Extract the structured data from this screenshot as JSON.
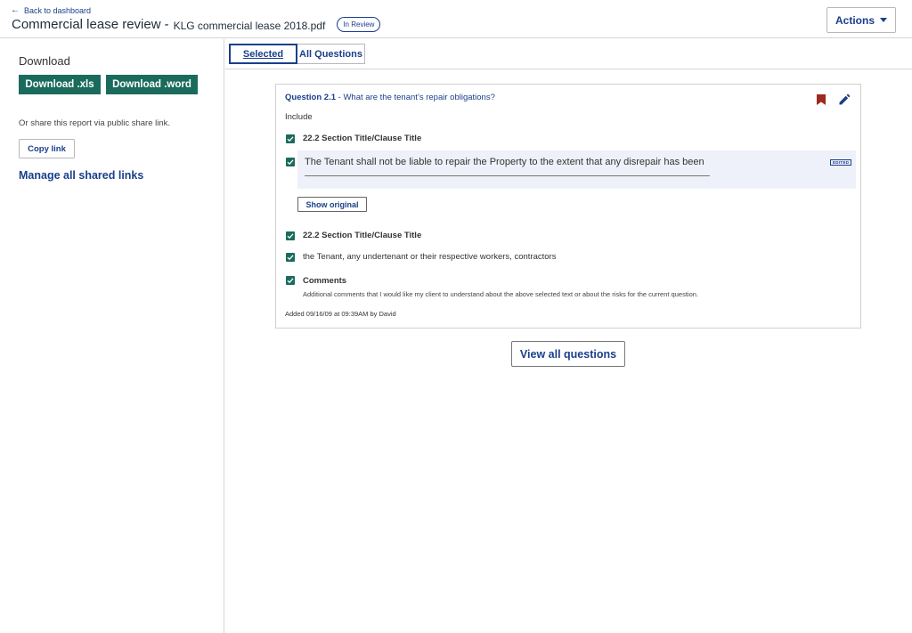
{
  "header": {
    "back_label": "Back to dashboard",
    "title": "Commercial lease review",
    "separator": "-",
    "file_name": "KLG commercial lease 2018.pdf",
    "status": "In Review",
    "actions_label": "Actions"
  },
  "sidebar": {
    "download_heading": "Download",
    "download_xls": "Download .xls",
    "download_word": "Download .word",
    "share_text": "Or share this report via public share link.",
    "copy_link": "Copy link",
    "manage_links": "Manage all shared links"
  },
  "tabs": [
    {
      "label": "Selected",
      "active": true
    },
    {
      "label": "All Questions",
      "active": false
    }
  ],
  "question": {
    "number": "Question 2.1",
    "separator": " - ",
    "text": "What are the tenant’s repair obligations?",
    "include_label": "Include",
    "items": [
      {
        "text": "22.2 Section Title/Clause Title",
        "checked": true
      },
      {
        "text": "The Tenant shall not be liable to repair the Property to the extent that any disrepair has been",
        "checked": true,
        "edited": true,
        "edited_badge": "EDITED"
      },
      {
        "text": "22.2 Section Title/Clause Title",
        "checked": true
      },
      {
        "text": "the Tenant, any undertenant or their respective workers, contractors",
        "checked": true
      },
      {
        "text": "Comments",
        "checked": true
      }
    ],
    "show_original": "Show original",
    "comments_detail": "Additional comments that I would like my client to understand about the above selected text or about the risks for the current question.",
    "added_by": "Added 09/16/09 at 09:39AM by David"
  },
  "view_all": "View all questions",
  "colors": {
    "accent": "#1a3f8a",
    "button_green": "#1b6b5d",
    "bookmark": "#9b2a1f",
    "edited_background": "#eef1f9"
  }
}
